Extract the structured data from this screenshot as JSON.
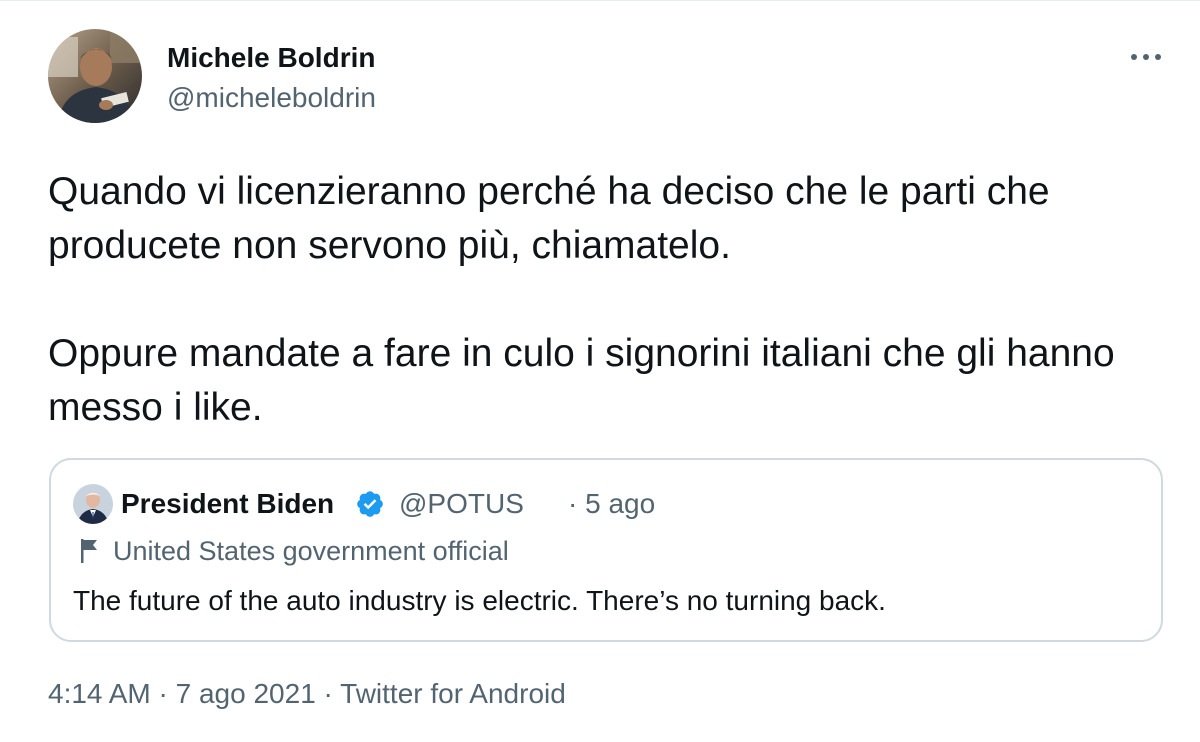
{
  "author": {
    "name": "Michele Boldrin",
    "handle": "@micheleboldrin"
  },
  "tweet": {
    "paragraphs": [
      "Quando vi licenzieranno perché ha deciso che le parti che producete non servono più, chiamatelo.",
      "Oppure mandate a fare in culo i signorini italiani che gli hanno messo i like."
    ]
  },
  "quoted": {
    "name": "President Biden",
    "handle": "@POTUS",
    "time": "· 5 ago",
    "label": "United States government official",
    "text": "The future of the auto industry is electric. There’s no turning back."
  },
  "meta": {
    "time": "4:14 AM",
    "sep1": " · ",
    "date": "7 ago 2021",
    "sep2": " · ",
    "source": "Twitter for Android"
  },
  "colors": {
    "verified": "#1d9bf0",
    "secondary_text": "#536471",
    "border": "#cfd9de"
  },
  "icons": {
    "more": "more-horizontal-icon",
    "verified": "verified-badge-icon",
    "flag": "government-flag-icon"
  }
}
